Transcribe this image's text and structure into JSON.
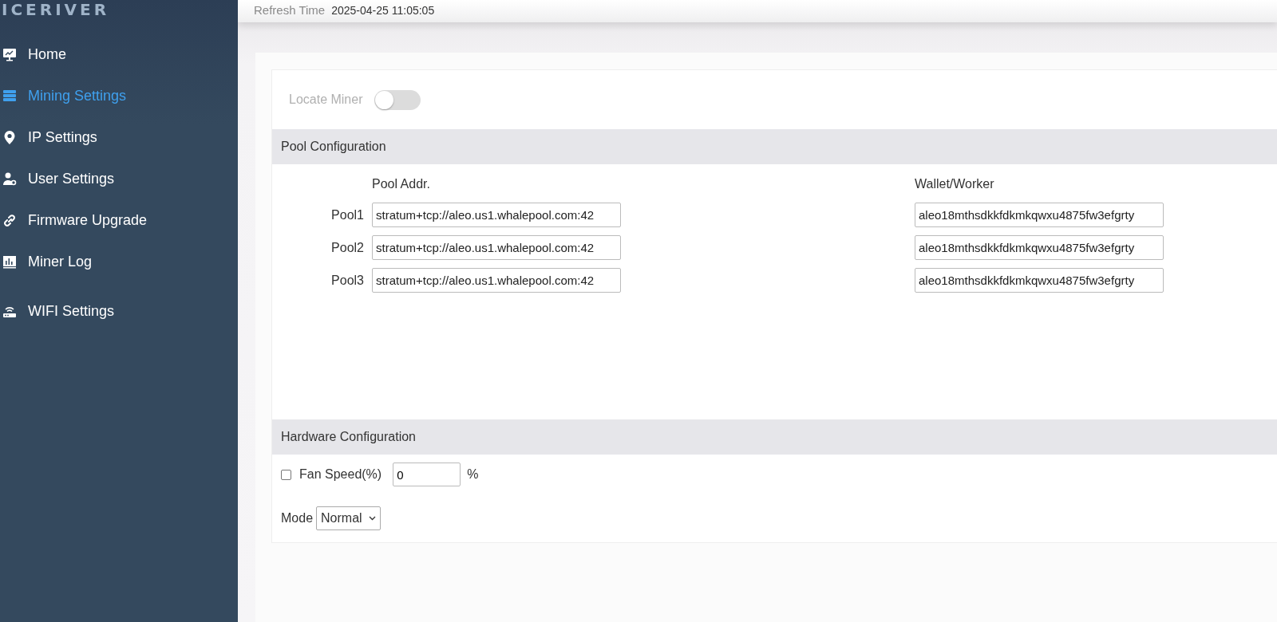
{
  "sidebar": {
    "logo": "ICERIVER",
    "items": [
      {
        "label": "Home",
        "selected": false
      },
      {
        "label": "Mining Settings",
        "selected": true
      },
      {
        "label": "IP Settings",
        "selected": false
      },
      {
        "label": "User Settings",
        "selected": false
      },
      {
        "label": "Firmware Upgrade",
        "selected": false
      },
      {
        "label": "Miner Log",
        "selected": false
      },
      {
        "label": "WIFI Settings",
        "selected": false
      }
    ]
  },
  "header": {
    "label": "Refresh Time",
    "value": "2025-04-25 11:05:05"
  },
  "locate_miner": {
    "label": "Locate Miner",
    "on": false
  },
  "pool_configuration": {
    "title": "Pool Configuration",
    "columns": [
      "Pool Addr.",
      "Wallet/Worker"
    ],
    "rows": [
      {
        "label": "Pool1",
        "address": "stratum+tcp://aleo.us1.whalepool.com:42",
        "wallet": "aleo18mthsdkkfdkmkqwxu4875fw3efgrty"
      },
      {
        "label": "Pool2",
        "address": "stratum+tcp://aleo.us1.whalepool.com:42",
        "wallet": "aleo18mthsdkkfdkmkqwxu4875fw3efgrty"
      },
      {
        "label": "Pool3",
        "address": "stratum+tcp://aleo.us1.whalepool.com:42",
        "wallet": "aleo18mthsdkkfdkmkqwxu4875fw3efgrty"
      }
    ]
  },
  "hardware_configuration": {
    "title": "Hardware Configuration",
    "fan_speed": {
      "label": "Fan Speed(%)",
      "checked": false,
      "value": "0",
      "unit": "%"
    },
    "mode": {
      "label": "Mode",
      "value": "Normal"
    }
  }
}
